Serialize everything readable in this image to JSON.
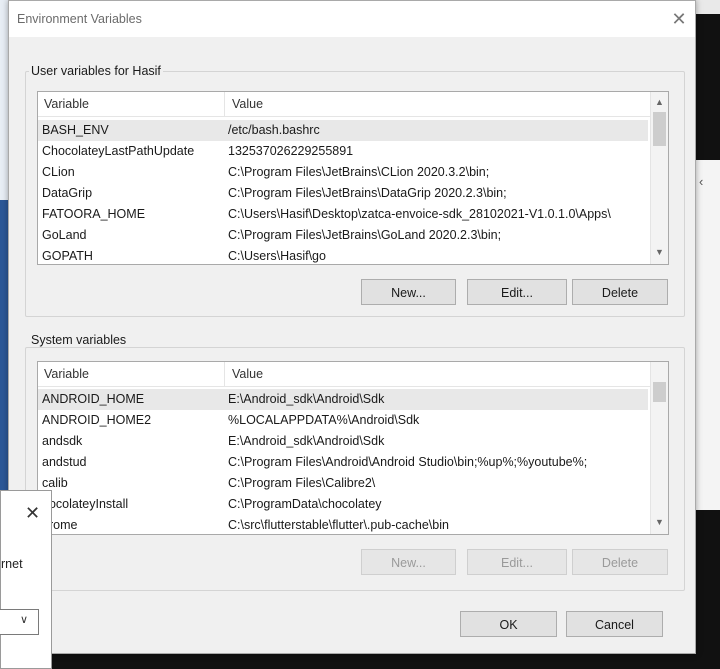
{
  "dialog": {
    "title": "Environment Variables",
    "close_glyph": "✕"
  },
  "user_vars": {
    "label": "User variables for Hasif",
    "columns": [
      "Variable",
      "Value"
    ],
    "rows": [
      {
        "variable": "BASH_ENV",
        "value": "/etc/bash.bashrc"
      },
      {
        "variable": "ChocolateyLastPathUpdate",
        "value": "132537026229255891"
      },
      {
        "variable": "CLion",
        "value": "C:\\Program Files\\JetBrains\\CLion 2020.3.2\\bin;"
      },
      {
        "variable": "DataGrip",
        "value": "C:\\Program Files\\JetBrains\\DataGrip 2020.2.3\\bin;"
      },
      {
        "variable": "FATOORA_HOME",
        "value": "C:\\Users\\Hasif\\Desktop\\zatca-envoice-sdk_28102021-V1.0.1.0\\Apps\\"
      },
      {
        "variable": "GoLand",
        "value": "C:\\Program Files\\JetBrains\\GoLand 2020.2.3\\bin;"
      },
      {
        "variable": "GOPATH",
        "value": "C:\\Users\\Hasif\\go"
      }
    ],
    "buttons": {
      "new": "New...",
      "edit": "Edit...",
      "delete": "Delete"
    }
  },
  "system_vars": {
    "label": "System variables",
    "columns": [
      "Variable",
      "Value"
    ],
    "rows": [
      {
        "variable": "ANDROID_HOME",
        "value": "E:\\Android_sdk\\Android\\Sdk"
      },
      {
        "variable": "ANDROID_HOME2",
        "value": "%LOCALAPPDATA%\\Android\\Sdk"
      },
      {
        "variable": "andsdk",
        "value": "E:\\Android_sdk\\Android\\Sdk"
      },
      {
        "variable": "andstud",
        "value": "C:\\Program Files\\Android\\Android Studio\\bin;%up%;%youtube%;"
      },
      {
        "variable": "calib",
        "value": "C:\\Program Files\\Calibre2\\"
      },
      {
        "variable": "hocolateyInstall",
        "value": "C:\\ProgramData\\chocolatey"
      },
      {
        "variable": "hrome",
        "value": "C:\\src\\flutterstable\\flutter\\.pub-cache\\bin"
      }
    ],
    "buttons": {
      "new": "New...",
      "edit": "Edit...",
      "delete": "Delete"
    }
  },
  "footer": {
    "ok": "OK",
    "cancel": "Cancel"
  },
  "small_dialog": {
    "close_glyph": "✕",
    "text": "rnet"
  },
  "colors": {
    "accent": "#0078d7",
    "selected_row": "#e8e8e8"
  }
}
